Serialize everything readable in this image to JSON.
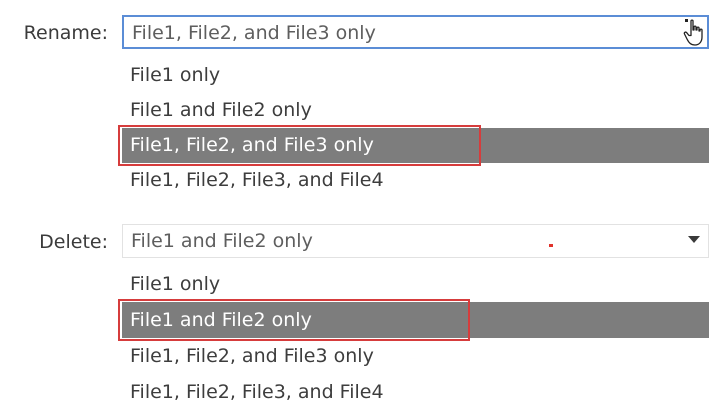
{
  "rename": {
    "label": "Rename:",
    "value": "File1, File2, and File3 only",
    "options": [
      "File1 only",
      "File1 and File2 only",
      "File1, File2, and File3 only",
      "File1, File2, File3, and File4"
    ],
    "selected_index": 2
  },
  "delete": {
    "label": "Delete:",
    "value": "File1 and File2 only",
    "options": [
      "File1 only",
      "File1 and File2 only",
      "File1, File2, and File3 only",
      "File1, File2, File3, and File4"
    ],
    "selected_index": 1
  },
  "colors": {
    "selected_bg": "#7d7d7d",
    "highlight_border": "#d63c3c",
    "focus_border": "#5b8dd6"
  },
  "icons": {
    "cursor": "hand-pointer-icon",
    "arrow": "chevron-down-icon"
  }
}
